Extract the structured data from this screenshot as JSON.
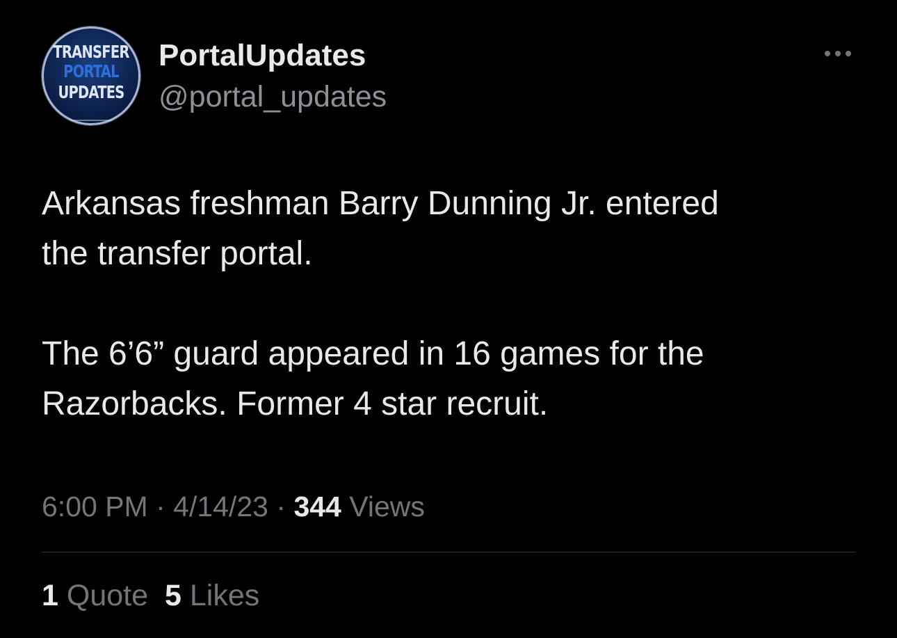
{
  "author": {
    "avatar_text": [
      "TRANSFER",
      "PORTAL",
      "UPDATES"
    ],
    "display_name": "PortalUpdates",
    "handle": "@portal_updates"
  },
  "tweet": {
    "paragraphs": [
      "Arkansas freshman Barry Dunning Jr. entered\nthe transfer portal.",
      "The 6’6” guard appeared in 16 games for the\nRazorbacks. Former 4 star recruit."
    ],
    "time": "6:00 PM",
    "separator": "·",
    "date": "4/14/23",
    "views_count": "344",
    "views_label": "Views"
  },
  "stats": {
    "quotes_count": "1",
    "quotes_label": "Quote",
    "likes_count": "5",
    "likes_label": "Likes"
  },
  "icons": {
    "more": "more-horizontal-icon"
  },
  "colors": {
    "background": "#000000",
    "primary_text": "#e7e9ea",
    "secondary_text": "#71767b",
    "divider": "#2f3336",
    "avatar_blue": "#2d6fe0"
  }
}
